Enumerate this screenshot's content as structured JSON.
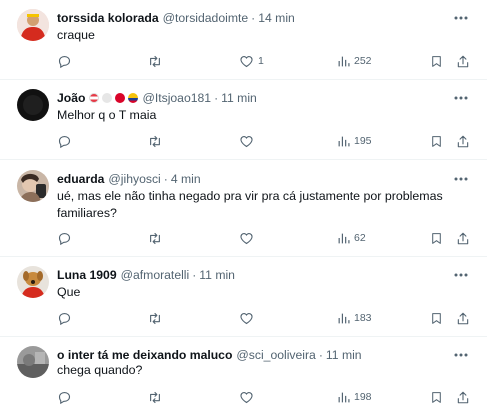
{
  "posts": [
    {
      "name": "torssida kolorada",
      "handle": "@torsidadoimte",
      "sep": "·",
      "time": "14 min",
      "text": "craque",
      "replies": "",
      "reposts": "",
      "likes": "1",
      "views": "252",
      "avatar": "red-shirt-avatar",
      "flags": []
    },
    {
      "name": "João",
      "handle": "@Itsjoao181",
      "sep": "·",
      "time": "11 min",
      "text": "Melhor q o T maia",
      "replies": "",
      "reposts": "",
      "likes": "",
      "views": "195",
      "avatar": "dark-circle-avatar",
      "flags": [
        "#e63946",
        "#e6e6e6",
        "#d90429",
        "#f4c20d"
      ]
    },
    {
      "name": "eduarda",
      "handle": "@jihyosci",
      "sep": "·",
      "time": "4 min",
      "text": "ué, mas ele não tinha negado pra vir pra cá justamente por problemas familiares?",
      "replies": "",
      "reposts": "",
      "likes": "",
      "views": "62",
      "avatar": "selfie-avatar",
      "flags": []
    },
    {
      "name": "Luna 1909",
      "handle": "@afmoratelli",
      "sep": "·",
      "time": "11 min",
      "text": "Que",
      "replies": "",
      "reposts": "",
      "likes": "",
      "views": "183",
      "avatar": "dog-avatar",
      "flags": []
    },
    {
      "name": "o inter tá me deixando maluco",
      "handle": "@sci_ooliveira",
      "sep": "·",
      "time": "11 min",
      "text": "chega quando?",
      "replies": "",
      "reposts": "",
      "likes": "",
      "views": "198",
      "avatar": "grey-photo-avatar",
      "flags": []
    }
  ],
  "icons": {
    "more": "more-options-icon",
    "reply": "reply-icon",
    "repost": "repost-icon",
    "like": "like-icon",
    "views": "views-icon",
    "bookmark": "bookmark-icon",
    "share": "share-icon"
  },
  "colors": {
    "text": "#0f1419",
    "secondary": "#536471",
    "divider": "#eff3f4"
  }
}
